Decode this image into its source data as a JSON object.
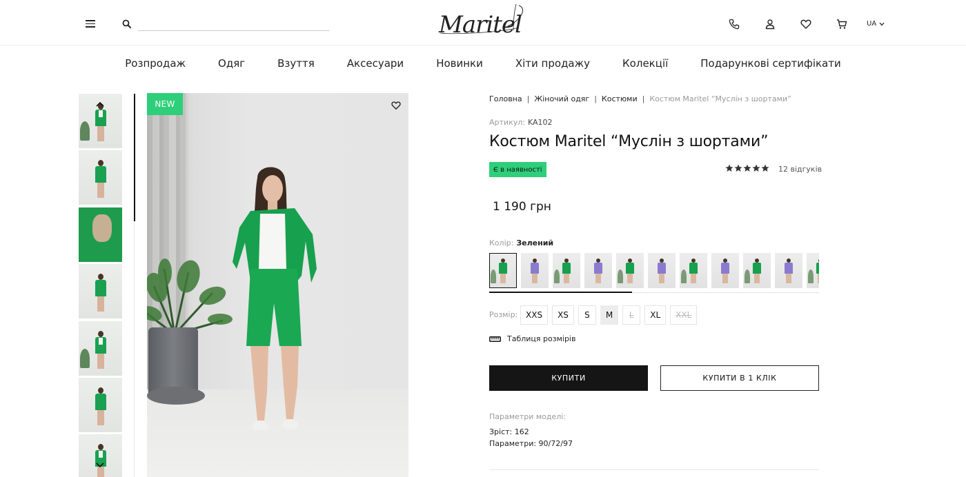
{
  "header": {
    "search_placeholder": "",
    "logo_text": "Maritel",
    "language": "UA",
    "icons": [
      "menu-icon",
      "search-icon",
      "phone-icon",
      "user-icon",
      "heart-icon",
      "cart-icon",
      "chevron-down-icon"
    ]
  },
  "nav": {
    "items": [
      "Розпродаж",
      "Одяг",
      "Взуття",
      "Аксесуари",
      "Новинки",
      "Хіти продажу",
      "Колекції",
      "Подарункові сертифікати"
    ]
  },
  "gallery": {
    "badge": "NEW",
    "thumbnail_count": 7,
    "accent_color": "#2ecf7a"
  },
  "product": {
    "breadcrumb": [
      "Головна",
      "Жіночий одяг",
      "Костюми",
      "Костюм Maritel “Муслін з шортами”"
    ],
    "sku_label": "Артикул:",
    "sku_value": "KA102",
    "title": "Костюм Maritel “Муслін з шортами”",
    "stock": "Є в наявності",
    "rating": 5,
    "reviews": "12 відгуків",
    "price": "1 190 грн",
    "color_label": "Колір:",
    "color_value": "Зелений",
    "swatches": [
      "green",
      "purple",
      "green",
      "purple",
      "green",
      "purple",
      "green",
      "purple",
      "green",
      "purple",
      "green"
    ],
    "size_label": "Розмір:",
    "sizes": [
      {
        "label": "XXS",
        "state": "available"
      },
      {
        "label": "XS",
        "state": "available"
      },
      {
        "label": "S",
        "state": "available"
      },
      {
        "label": "M",
        "state": "selected"
      },
      {
        "label": "L",
        "state": "unavailable"
      },
      {
        "label": "XL",
        "state": "available"
      },
      {
        "label": "XXL",
        "state": "unavailable"
      }
    ],
    "size_table": "Таблиця розмірів",
    "buy_button": "КУПИТИ",
    "one_click_button": "КУПИТИ В 1 КЛІК",
    "params_title": "Параметри моделі:",
    "height": "Зріст: 162",
    "measurements": "Параметри: 90/72/97"
  }
}
